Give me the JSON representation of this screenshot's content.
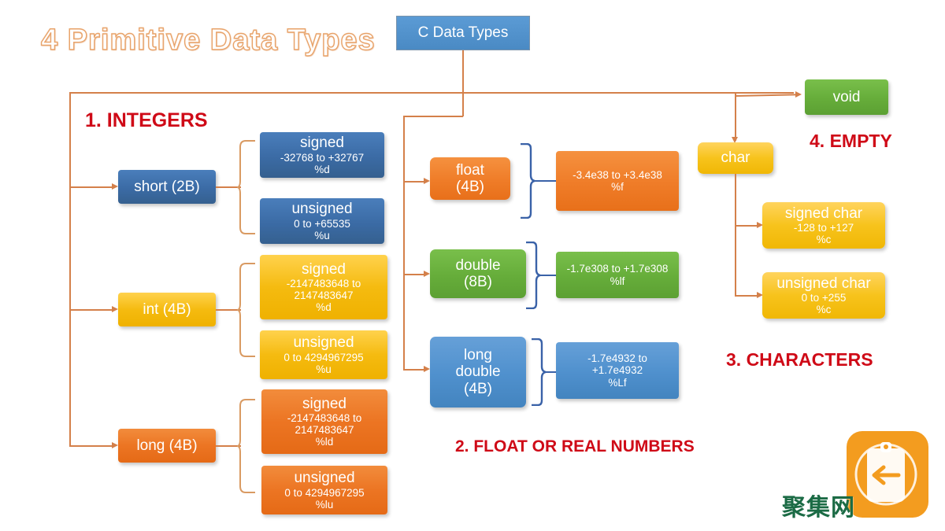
{
  "slide": {
    "title": "4 Primitive Data Types",
    "root": {
      "label": "C Data Types"
    },
    "sections": [
      {
        "id": "integers",
        "label": "1. INTEGERS"
      },
      {
        "id": "floats",
        "label": "2. FLOAT OR REAL NUMBERS"
      },
      {
        "id": "characters",
        "label": "3. CHARACTERS"
      },
      {
        "id": "empty",
        "label": "4. EMPTY"
      }
    ],
    "integers": {
      "types": [
        {
          "name": "short (2B)",
          "color": "#3b6ba5",
          "variants": [
            {
              "title": "signed",
              "range": "-32768 to +32767",
              "format": "%d"
            },
            {
              "title": "unsigned",
              "range": "0 to +65535",
              "format": "%u"
            }
          ]
        },
        {
          "name": "int (4B)",
          "color": "#f5bb10",
          "variants": [
            {
              "title": "signed",
              "range_line1": "-2147483648 to",
              "range_line2": "2147483647",
              "format": "%d"
            },
            {
              "title": "unsigned",
              "range": "0 to 4294967295",
              "format": "%u"
            }
          ]
        },
        {
          "name": "long (4B)",
          "color": "#ec7523",
          "variants": [
            {
              "title": "signed",
              "range_line1": "-2147483648 to",
              "range_line2": "2147483647",
              "format": "%ld"
            },
            {
              "title": "unsigned",
              "range": "0 to 4294967295",
              "format": "%lu"
            }
          ]
        }
      ]
    },
    "floats": {
      "types": [
        {
          "name_line1": "float",
          "name_line2": "(4B)",
          "color": "#ec7523",
          "detail": {
            "range": "-3.4e38 to +3.4e38",
            "format": "%f"
          }
        },
        {
          "name_line1": "double",
          "name_line2": "(8B)",
          "color": "#66ad3a",
          "detail": {
            "range": "-1.7e308 to +1.7e308",
            "format": "%lf"
          }
        },
        {
          "name_line1": "long",
          "name_line2": "double",
          "name_line3": "(4B)",
          "color": "#4f90cd",
          "detail": {
            "range_line1": "-1.7e4932 to",
            "range_line2": "+1.7e4932",
            "format": "%Lf"
          }
        }
      ]
    },
    "characters": {
      "parent": {
        "label": "char",
        "color": "#f5bb10"
      },
      "variants": [
        {
          "title": "signed char",
          "range": "-128 to +127",
          "format": "%c"
        },
        {
          "title": "unsigned char",
          "range": "0 to +255",
          "format": "%c"
        }
      ]
    },
    "empty": {
      "node": {
        "label": "void",
        "color": "#66ad3a"
      }
    },
    "watermark": {
      "text": "聚集网",
      "icon": "clipboard-back-arrow-icon",
      "color": "#f39c1f"
    },
    "colors": {
      "connector": "#d4804a",
      "brace": "#3a62a8",
      "section_label": "#cf0a17",
      "title_outline": "#e8a36a"
    }
  }
}
